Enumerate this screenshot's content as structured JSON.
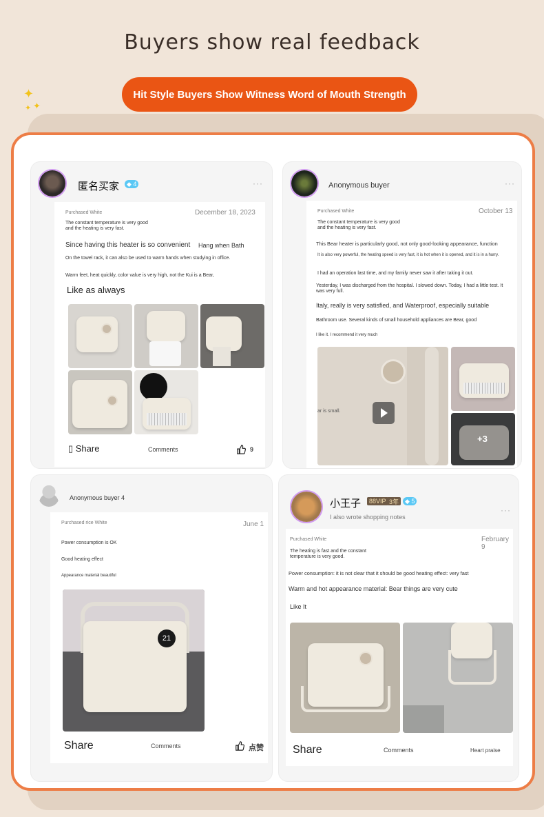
{
  "header": {
    "title": "Buyers show real feedback",
    "pill_label": "Hit Style Buyers Show Witness Word of Mouth Strength"
  },
  "colors": {
    "accent": "#ea5514",
    "frame": "#ed7d46",
    "background": "#f1e5d9",
    "vip_badge": "#5ac8f5"
  },
  "reviews": [
    {
      "user": "匿名买家",
      "badge": "4",
      "more": "···",
      "variant": "Purchased White",
      "date": "December 18, 2023",
      "summary": "The constant temperature is very good and the heating is very fast.",
      "line1a": "Since having this heater is so convenient",
      "line1b": "Hang when Bath",
      "line2": "On the towel rack, it can also be used to warm hands when studying in office.",
      "line3": "Warm feet, heat quickly, color value is very high, not the Kui is a Bear,",
      "line4": "Like as always",
      "share": "Share",
      "comments": "Comments",
      "likes": "9"
    },
    {
      "user": "Anonymous buyer",
      "more": "···",
      "variant": "Purchased White",
      "date": "October 13",
      "summary": "The constant temperature is very good and the heating is very fast.",
      "line1": "This Bear heater is particularly good, not only good-looking appearance, function",
      "line2": "It is also very powerful, the heating speed is very fast, it is hot when it is opened, and it is in a hurry.",
      "line3": "I had an operation last time, and my family never saw it after taking it out.",
      "line4": "Yesterday, I was discharged from the hospital. I slowed down. Today, I had a little test. It was very full.",
      "line5": "Italy, really is very satisfied, and Waterproof, especially suitable",
      "line6": "Bathroom use. Several kinds of small household appliances are Bear, good",
      "line7": "I like it. I recommend it very much",
      "video_caption": "ar is small.",
      "more_photos": "+3"
    },
    {
      "user": "Anonymous buyer 4",
      "variant": "Purchased rice White",
      "date": "June 1",
      "line1": "Power consumption is OK",
      "line2": "Good heating effect",
      "line3": "Appearance material beautiful",
      "display": "21",
      "share": "Share",
      "comments": "Comments",
      "likes": "点赞"
    },
    {
      "user": "小王子",
      "vip": "88VIP",
      "years": "3年",
      "badge": "5",
      "subtitle": "I also wrote shopping notes",
      "more": "···",
      "variant": "Purchased White",
      "date": "February 9",
      "summary": "The heating is fast and the constant temperature is very good.",
      "line1": "Power consumption: it is not clear that it should be good heating effect: very fast",
      "line2": "Warm and hot appearance material: Bear things are very cute",
      "line3": "Like It",
      "share": "Share",
      "comments": "Comments",
      "likes": "Heart praise"
    }
  ]
}
